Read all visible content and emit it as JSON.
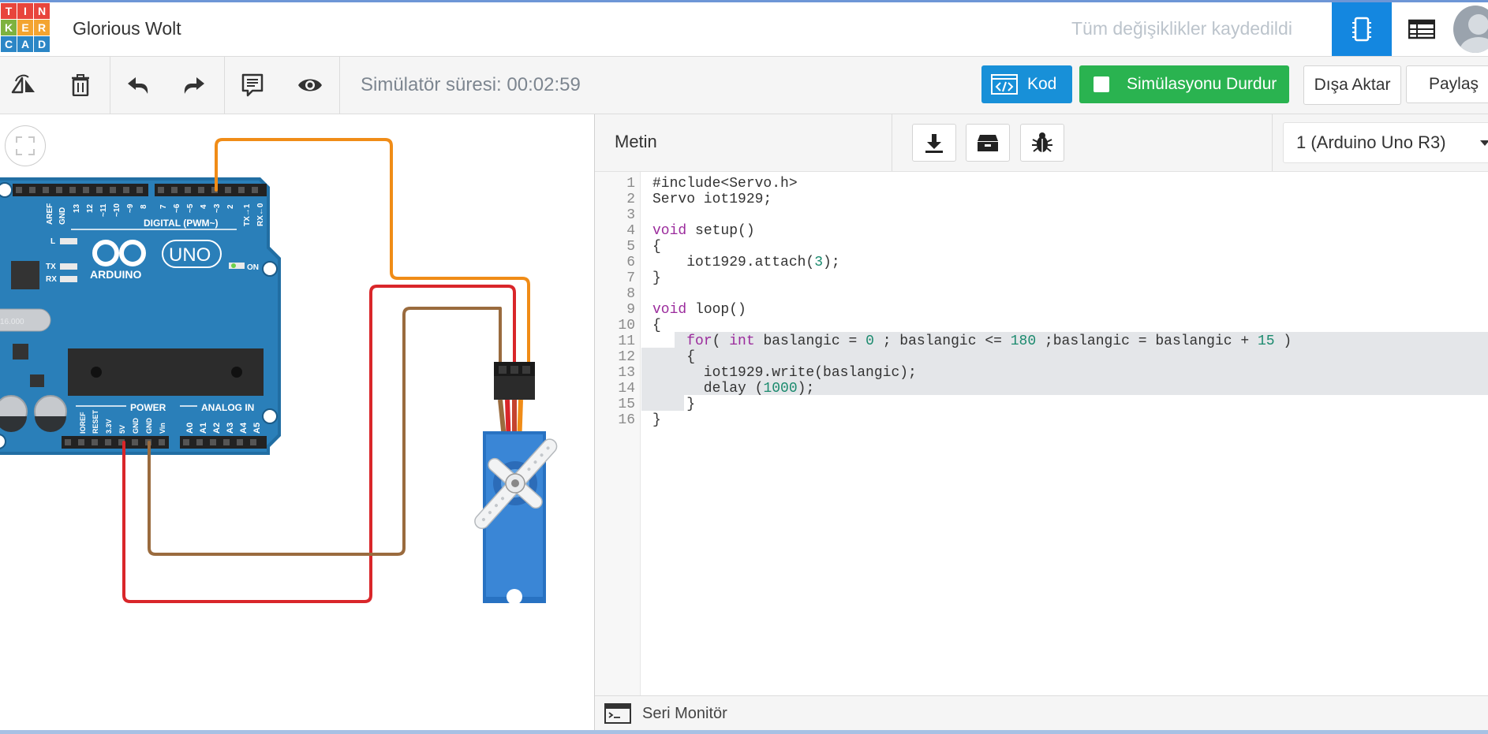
{
  "logo": {
    "letters": [
      "T",
      "I",
      "N",
      "K",
      "E",
      "R",
      "C",
      "A",
      "D"
    ],
    "colors": [
      "#e8453c",
      "#e8453c",
      "#e8453c",
      "#7eb23f",
      "#f3a431",
      "#f3a431",
      "#2b86c6",
      "#2b86c6",
      "#2b86c6"
    ]
  },
  "header": {
    "project_name": "Glorious Wolt",
    "save_status": "Tüm değişiklikler kaydedildi",
    "circuit_view_icon": "breadboard-icon",
    "list_view_icon": "list-icon",
    "accent_color": "#1487e0"
  },
  "toolbar": {
    "icons": [
      "rotate-icon",
      "delete-icon",
      "undo-icon",
      "redo-icon",
      "notes-icon",
      "visibility-icon"
    ],
    "sim_time": "Simülatör süresi: 00:02:59",
    "code_button": "Kod",
    "stop_button": "Simülasyonu Durdur",
    "export_button": "Dışa Aktar",
    "share_button": "Paylaş",
    "code_color": "#1890d8",
    "stop_color": "#2ab350"
  },
  "board": {
    "brand": "ARDUINO",
    "model": "UNO",
    "digital_label": "DIGITAL (PWM~)",
    "power_label": "POWER",
    "analog_label": "ANALOG IN",
    "on_label": "ON",
    "l_label": "L",
    "tx_label": "TX",
    "rx_label": "RX",
    "aref": "AREF",
    "gnd": "GND",
    "digital_pins": [
      "13",
      "12",
      "~11",
      "~10",
      "~9",
      "8",
      "7",
      "~6",
      "~5",
      "4",
      "~3",
      "2",
      "TX→1",
      "RX←0"
    ],
    "power_pins": [
      "IOREF",
      "RESET",
      "3.3V",
      "5V",
      "GND",
      "GND",
      "Vin"
    ],
    "analog_pins": [
      "A0",
      "A1",
      "A2",
      "A3",
      "A4",
      "A5"
    ],
    "crystal_label": "16.000"
  },
  "wires": {
    "signal": "#f08c17",
    "power": "#d9262a",
    "ground": "#9a6b3e"
  },
  "code": {
    "mode": "Metin",
    "tools": [
      "download-icon",
      "library-icon",
      "debug-icon"
    ],
    "board_select": "1 (Arduino Uno R3)",
    "lines": [
      "#include<Servo.h>",
      "Servo iot1929;",
      "",
      "void setup()",
      "{",
      "    iot1929.attach(3);",
      "}",
      "",
      "void loop()",
      "{",
      "    for( int baslangic = 0 ; baslangic <= 180 ;baslangic = baslangic + 15 )",
      "    {",
      "      iot1929.write(baslangic);",
      "      delay (1000);",
      "    }",
      "}"
    ],
    "line_numbers": [
      "1",
      "2",
      "3",
      "4",
      "5",
      "6",
      "7",
      "8",
      "9",
      "10",
      "11",
      "12",
      "13",
      "14",
      "15",
      "16"
    ],
    "highlighted_lines": [
      11,
      12,
      13,
      14,
      15
    ]
  },
  "serial_monitor": {
    "label": "Seri Monitör"
  }
}
